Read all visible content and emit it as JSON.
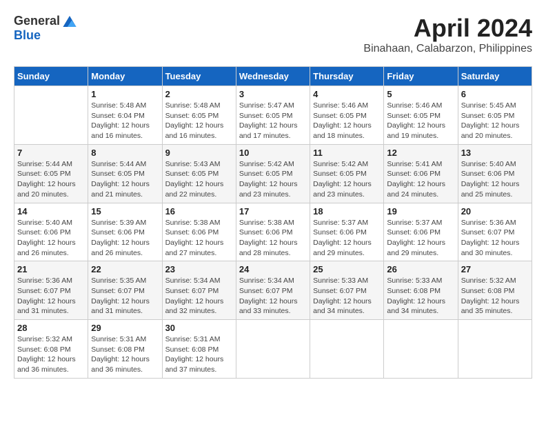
{
  "header": {
    "logo_general": "General",
    "logo_blue": "Blue",
    "month_title": "April 2024",
    "subtitle": "Binahaan, Calabarzon, Philippines"
  },
  "calendar": {
    "days_of_week": [
      "Sunday",
      "Monday",
      "Tuesday",
      "Wednesday",
      "Thursday",
      "Friday",
      "Saturday"
    ],
    "weeks": [
      [
        {
          "day": "",
          "info": ""
        },
        {
          "day": "1",
          "info": "Sunrise: 5:48 AM\nSunset: 6:04 PM\nDaylight: 12 hours\nand 16 minutes."
        },
        {
          "day": "2",
          "info": "Sunrise: 5:48 AM\nSunset: 6:05 PM\nDaylight: 12 hours\nand 16 minutes."
        },
        {
          "day": "3",
          "info": "Sunrise: 5:47 AM\nSunset: 6:05 PM\nDaylight: 12 hours\nand 17 minutes."
        },
        {
          "day": "4",
          "info": "Sunrise: 5:46 AM\nSunset: 6:05 PM\nDaylight: 12 hours\nand 18 minutes."
        },
        {
          "day": "5",
          "info": "Sunrise: 5:46 AM\nSunset: 6:05 PM\nDaylight: 12 hours\nand 19 minutes."
        },
        {
          "day": "6",
          "info": "Sunrise: 5:45 AM\nSunset: 6:05 PM\nDaylight: 12 hours\nand 20 minutes."
        }
      ],
      [
        {
          "day": "7",
          "info": "Sunrise: 5:44 AM\nSunset: 6:05 PM\nDaylight: 12 hours\nand 20 minutes."
        },
        {
          "day": "8",
          "info": "Sunrise: 5:44 AM\nSunset: 6:05 PM\nDaylight: 12 hours\nand 21 minutes."
        },
        {
          "day": "9",
          "info": "Sunrise: 5:43 AM\nSunset: 6:05 PM\nDaylight: 12 hours\nand 22 minutes."
        },
        {
          "day": "10",
          "info": "Sunrise: 5:42 AM\nSunset: 6:05 PM\nDaylight: 12 hours\nand 23 minutes."
        },
        {
          "day": "11",
          "info": "Sunrise: 5:42 AM\nSunset: 6:05 PM\nDaylight: 12 hours\nand 23 minutes."
        },
        {
          "day": "12",
          "info": "Sunrise: 5:41 AM\nSunset: 6:06 PM\nDaylight: 12 hours\nand 24 minutes."
        },
        {
          "day": "13",
          "info": "Sunrise: 5:40 AM\nSunset: 6:06 PM\nDaylight: 12 hours\nand 25 minutes."
        }
      ],
      [
        {
          "day": "14",
          "info": "Sunrise: 5:40 AM\nSunset: 6:06 PM\nDaylight: 12 hours\nand 26 minutes."
        },
        {
          "day": "15",
          "info": "Sunrise: 5:39 AM\nSunset: 6:06 PM\nDaylight: 12 hours\nand 26 minutes."
        },
        {
          "day": "16",
          "info": "Sunrise: 5:38 AM\nSunset: 6:06 PM\nDaylight: 12 hours\nand 27 minutes."
        },
        {
          "day": "17",
          "info": "Sunrise: 5:38 AM\nSunset: 6:06 PM\nDaylight: 12 hours\nand 28 minutes."
        },
        {
          "day": "18",
          "info": "Sunrise: 5:37 AM\nSunset: 6:06 PM\nDaylight: 12 hours\nand 29 minutes."
        },
        {
          "day": "19",
          "info": "Sunrise: 5:37 AM\nSunset: 6:06 PM\nDaylight: 12 hours\nand 29 minutes."
        },
        {
          "day": "20",
          "info": "Sunrise: 5:36 AM\nSunset: 6:07 PM\nDaylight: 12 hours\nand 30 minutes."
        }
      ],
      [
        {
          "day": "21",
          "info": "Sunrise: 5:36 AM\nSunset: 6:07 PM\nDaylight: 12 hours\nand 31 minutes."
        },
        {
          "day": "22",
          "info": "Sunrise: 5:35 AM\nSunset: 6:07 PM\nDaylight: 12 hours\nand 31 minutes."
        },
        {
          "day": "23",
          "info": "Sunrise: 5:34 AM\nSunset: 6:07 PM\nDaylight: 12 hours\nand 32 minutes."
        },
        {
          "day": "24",
          "info": "Sunrise: 5:34 AM\nSunset: 6:07 PM\nDaylight: 12 hours\nand 33 minutes."
        },
        {
          "day": "25",
          "info": "Sunrise: 5:33 AM\nSunset: 6:07 PM\nDaylight: 12 hours\nand 34 minutes."
        },
        {
          "day": "26",
          "info": "Sunrise: 5:33 AM\nSunset: 6:08 PM\nDaylight: 12 hours\nand 34 minutes."
        },
        {
          "day": "27",
          "info": "Sunrise: 5:32 AM\nSunset: 6:08 PM\nDaylight: 12 hours\nand 35 minutes."
        }
      ],
      [
        {
          "day": "28",
          "info": "Sunrise: 5:32 AM\nSunset: 6:08 PM\nDaylight: 12 hours\nand 36 minutes."
        },
        {
          "day": "29",
          "info": "Sunrise: 5:31 AM\nSunset: 6:08 PM\nDaylight: 12 hours\nand 36 minutes."
        },
        {
          "day": "30",
          "info": "Sunrise: 5:31 AM\nSunset: 6:08 PM\nDaylight: 12 hours\nand 37 minutes."
        },
        {
          "day": "",
          "info": ""
        },
        {
          "day": "",
          "info": ""
        },
        {
          "day": "",
          "info": ""
        },
        {
          "day": "",
          "info": ""
        }
      ]
    ]
  }
}
